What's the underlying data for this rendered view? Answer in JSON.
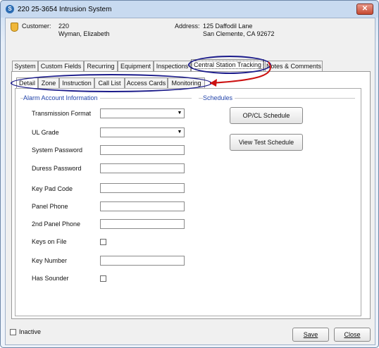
{
  "window": {
    "title": "220 25-3654 Intrusion System",
    "close_glyph": "✕"
  },
  "header": {
    "customer_label": "Customer:",
    "customer_id": "220",
    "customer_name": "Wyman, Elizabeth",
    "address_label": "Address:",
    "address_line1": "125 Daffodil Lane",
    "address_line2": "San Clemente, CA  92672"
  },
  "main_tabs": [
    "System",
    "Custom Fields",
    "Recurring",
    "Equipment",
    "Inspections",
    "Central Station Tracking",
    "Notes & Comments"
  ],
  "sub_tabs": [
    "Detail",
    "Zone",
    "Instruction",
    "Call List",
    "Access Cards",
    "Monitoring"
  ],
  "alarm_account": {
    "group_title": "Alarm Account Information",
    "fields": {
      "transmission_format": {
        "label": "Transmission Format",
        "value": ""
      },
      "ul_grade": {
        "label": "UL Grade",
        "value": ""
      },
      "system_password": {
        "label": "System Password",
        "value": ""
      },
      "duress_password": {
        "label": "Duress Password",
        "value": ""
      },
      "key_pad_code": {
        "label": "Key Pad Code",
        "value": ""
      },
      "panel_phone": {
        "label": "Panel Phone",
        "value": ""
      },
      "panel_phone_2": {
        "label": "2nd Panel Phone",
        "value": ""
      },
      "keys_on_file": {
        "label": "Keys on File",
        "checked": false
      },
      "key_number": {
        "label": "Key Number",
        "value": ""
      },
      "has_sounder": {
        "label": "Has Sounder",
        "checked": false
      }
    }
  },
  "schedules": {
    "group_title": "Schedules",
    "opcl_button": "OP/CL Schedule",
    "test_button": "View Test Schedule"
  },
  "footer": {
    "inactive_label": "Inactive",
    "inactive_checked": false,
    "save_label": "Save",
    "close_label": "Close"
  },
  "colors": {
    "annotation_ellipse": "#1a1a8a",
    "annotation_arrow": "#cc1111",
    "group_title": "#2244aa"
  }
}
